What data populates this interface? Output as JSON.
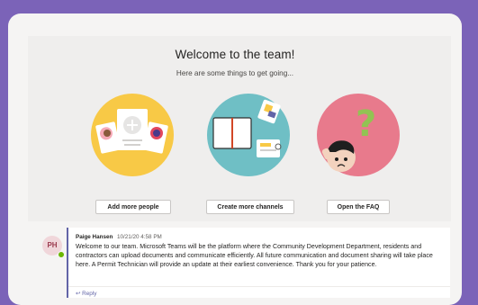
{
  "welcome": {
    "title": "Welcome to the team!",
    "subtitle": "Here are some things to get going..."
  },
  "actions": {
    "add_people": "Add more people",
    "create_channels": "Create more channels",
    "open_faq": "Open the FAQ"
  },
  "post": {
    "initials": "PH",
    "author": "Paige Hansen",
    "timestamp": "10/21/20 4:58 PM",
    "body": "Welcome to our team. Microsoft Teams will be the platform where the Community Development Department, residents and contractors can upload documents and communicate efficiently.  All future communication and document sharing will take place here. A Permit Technician will provide an update at their earliest convenience. Thank you for your patience.",
    "reply_label": "Reply",
    "presence_color": "#6BB700"
  },
  "icons": {
    "people": "people-cards-illustration",
    "channels": "notebook-illustration",
    "faq": "question-illustration",
    "reply": "reply-arrow-icon"
  },
  "colors": {
    "background": "#7B63B8",
    "accent": "#6264A7",
    "people_circle": "#F8C946",
    "channels_circle": "#6FBFC5",
    "faq_circle": "#E87A8C"
  }
}
